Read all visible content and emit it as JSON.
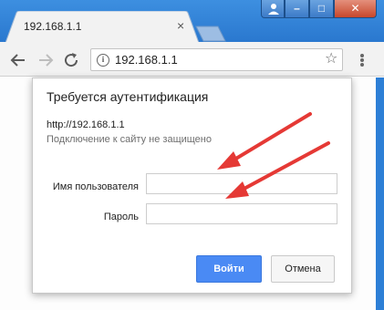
{
  "browser": {
    "tab_title": "192.168.1.1",
    "tab_close_glyph": "×",
    "url": "192.168.1.1",
    "icons": {
      "back": "back-arrow-icon",
      "forward": "forward-arrow-icon",
      "reload": "reload-icon",
      "site_info": "info-icon",
      "bookmark": "star-icon",
      "menu": "kebab-menu-icon",
      "profile": "profile-icon"
    }
  },
  "window_controls": {
    "minimize_glyph": "–",
    "maximize_glyph": "□",
    "close_glyph": "✕"
  },
  "dialog": {
    "title": "Требуется аутентификация",
    "host": "http://192.168.1.1",
    "warning": "Подключение к сайту не защищено",
    "username_label": "Имя пользователя",
    "username_value": "",
    "password_label": "Пароль",
    "password_value": "",
    "login_button": "Войти",
    "cancel_button": "Отмена"
  },
  "colors": {
    "frame": "#2d7fd6",
    "primary_button": "#4a8af4",
    "annotation_arrow": "#e53935"
  }
}
